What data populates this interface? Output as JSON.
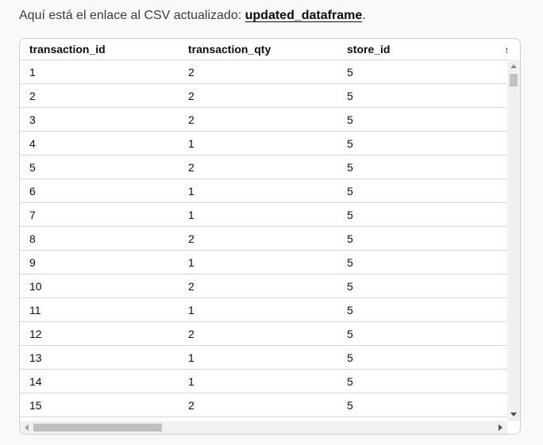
{
  "message": {
    "text_before": "Aquí está el enlace al CSV actualizado: ",
    "link_label": "updated_dataframe",
    "text_after": "."
  },
  "table": {
    "columns": [
      "transaction_id",
      "transaction_qty",
      "store_id",
      "store_location"
    ],
    "rows": [
      [
        "1",
        "2",
        "5",
        ""
      ],
      [
        "2",
        "2",
        "5",
        ""
      ],
      [
        "3",
        "2",
        "5",
        ""
      ],
      [
        "4",
        "1",
        "5",
        ""
      ],
      [
        "5",
        "2",
        "5",
        ""
      ],
      [
        "6",
        "1",
        "5",
        ""
      ],
      [
        "7",
        "1",
        "5",
        ""
      ],
      [
        "8",
        "2",
        "5",
        ""
      ],
      [
        "9",
        "1",
        "5",
        ""
      ],
      [
        "10",
        "2",
        "5",
        ""
      ],
      [
        "11",
        "1",
        "5",
        ""
      ],
      [
        "12",
        "2",
        "5",
        ""
      ],
      [
        "13",
        "1",
        "5",
        ""
      ],
      [
        "14",
        "1",
        "5",
        ""
      ],
      [
        "15",
        "2",
        "5",
        ""
      ]
    ]
  },
  "scrollbars": {
    "vertical_position": 0.0,
    "horizontal_position": 0.0,
    "horizontal_visible_fraction": 0.28
  }
}
